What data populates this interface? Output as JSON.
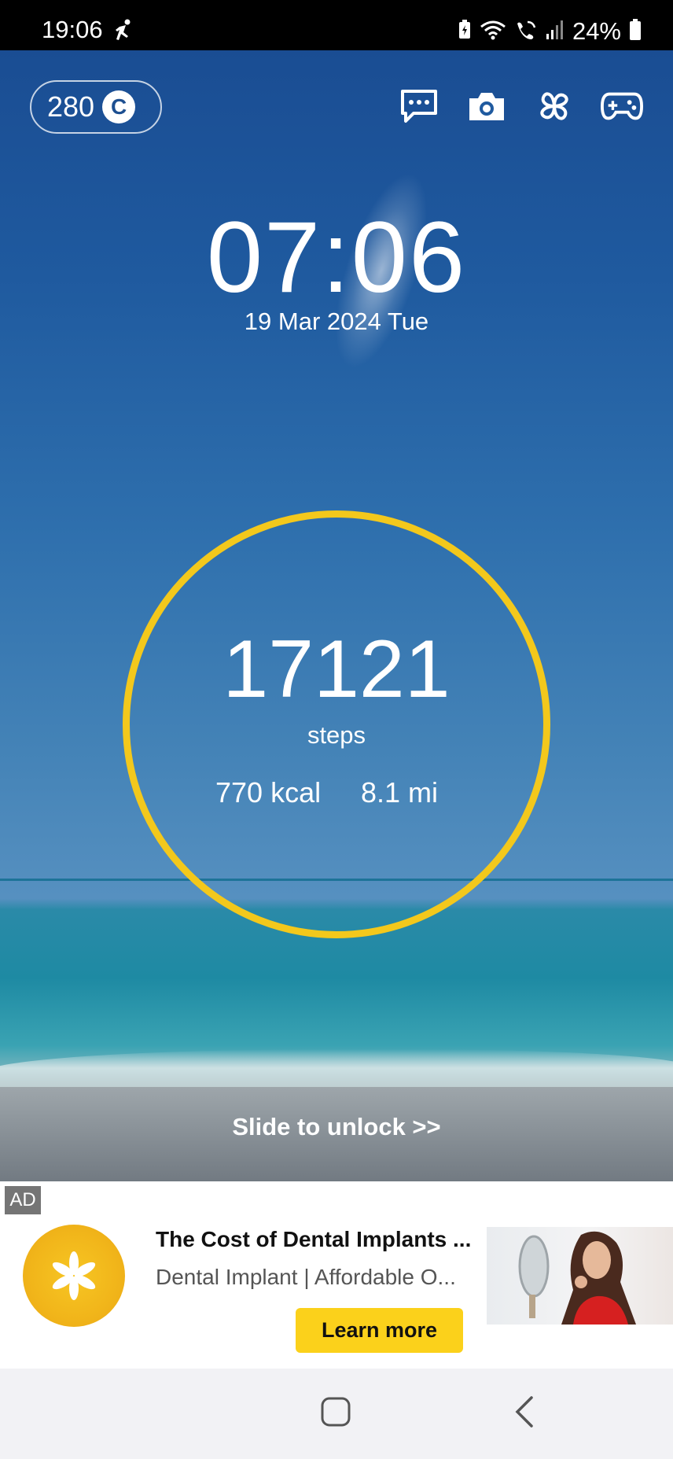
{
  "status_bar": {
    "time": "19:06",
    "battery_percent": "24%",
    "icons": [
      "runner-icon",
      "battery-saver-icon",
      "wifi-icon",
      "wifi-calling-icon",
      "signal-icon",
      "battery-icon"
    ]
  },
  "lock_screen": {
    "coins": "280",
    "coin_symbol": "C",
    "top_icons": [
      "chat-icon",
      "camera-icon",
      "clover-icon",
      "gamepad-icon"
    ],
    "clock": "07:06",
    "date": "19 Mar 2024 Tue",
    "steps": "17121",
    "steps_label": "steps",
    "kcal": "770 kcal",
    "distance": "8.1 mi",
    "slide_text": "Slide to unlock >>",
    "ring_color": "#f3c81c"
  },
  "ad": {
    "tag": "AD",
    "title": "The Cost of Dental Implants ...",
    "subtitle": "Dental Implant | Affordable O...",
    "cta": "Learn more",
    "cta_color": "#fbd11b"
  },
  "nav_bar": {
    "icons": [
      "home-square-icon",
      "back-chevron-icon"
    ]
  }
}
